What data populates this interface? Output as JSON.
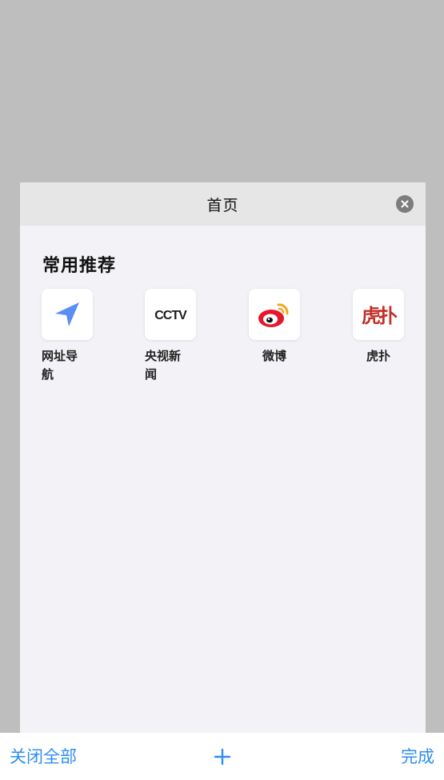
{
  "tab": {
    "title": "首页"
  },
  "section": {
    "title": "常用推荐"
  },
  "apps": [
    {
      "label": "网址导航",
      "icon": "navigation-arrow-icon"
    },
    {
      "label": "央视新闻",
      "icon": "cctv-logo-icon",
      "logo_text": "CCTV"
    },
    {
      "label": "微博",
      "icon": "weibo-logo-icon"
    },
    {
      "label": "虎扑",
      "icon": "hupu-logo-icon",
      "logo_text": "虎扑"
    }
  ],
  "bottom_bar": {
    "close_all_label": "关闭全部",
    "add_icon": "plus-icon",
    "done_label": "完成"
  },
  "colors": {
    "backdrop": "#bebebe",
    "card_bg": "#f2f2f7",
    "header_bg": "#e6e6e6",
    "accent": "#2f8ef0",
    "nav_arrow": "#5a8ef5",
    "hupu_red": "#c0302a",
    "weibo_red": "#e6162d",
    "weibo_orange": "#f5a623"
  }
}
